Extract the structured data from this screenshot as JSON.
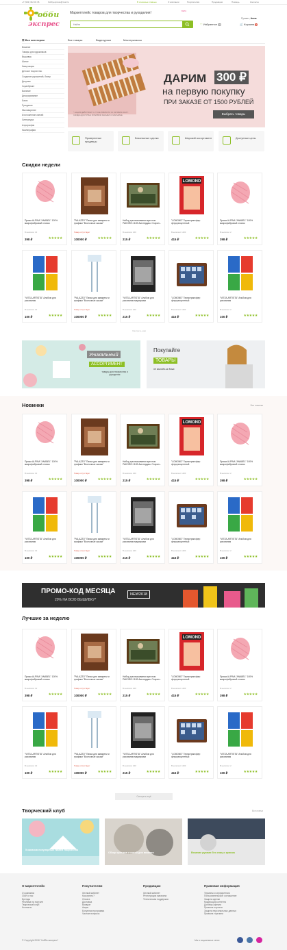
{
  "topbar": {
    "phone": "+7 (902) 342 34 36",
    "email": "hobbyexpress@mail.ru",
    "help": "В основные главные",
    "links": [
      "О компании",
      "Покупателям",
      "Продавцам",
      "Помощь",
      "Контакты"
    ]
  },
  "header": {
    "slogan": "Маркетплейс товаров для творчества и рукоделия!",
    "beta": "BETA",
    "greeting": "Привет,",
    "user": "Анна",
    "search_placeholder": "Найти",
    "favorites": "Избранное",
    "favorites_count": "99",
    "cart": "Корзина",
    "cart_count": "0"
  },
  "nav": {
    "all": "Все категории",
    "items": [
      "Все товары",
      "Видеоуроки",
      "Мастерклассы"
    ]
  },
  "sidebar": [
    "Вязание",
    "Товары для художников",
    "Вышивка",
    "Шитье",
    "Канцтовары",
    "Детское творчество",
    "Создание украшений, бисер",
    "Декупаж",
    "Скрапбукинг",
    "Валяние",
    "Декорирование",
    "Батик",
    "Рукоделие",
    "Мыловарение",
    "Изготовление свечей",
    "Литература",
    "Аэрография",
    "Каллиграфия"
  ],
  "banner": {
    "line1": "ДАРИМ",
    "amount": "300 ₽",
    "line2": "на первую покупку",
    "line3": "ПРИ ЗАКАЗЕ ОТ 1500 РУБЛЕЙ",
    "fine1": "* АКЦИЯ ДЕЙСТВУЕТ С 27 СЕНТЯБРЯ ПО 15 ОКТЯБРЯ 2018 Г.",
    "fine2": "СКИДКА ДОСТУПНА В ПЕРВОМ ЗАКАЗЕ В 1 МАГАЗИНЕ",
    "cta": "Выбрать товары"
  },
  "features": [
    "Проверенные продавцы",
    "Безопасные сделки",
    "Широкий ассортимент",
    "Доступные цены"
  ],
  "sections": {
    "sale": "Скидки недели",
    "new": "Новинки",
    "best": "Лучшие за неделю",
    "club": "Творческий клуб",
    "all": "Все новинки",
    "all2": "Все статьи",
    "show_more": "Смотреть ещё"
  },
  "products_row1": [
    {
      "name": "Пряжа ALPINA \"ANABEL\" 100% микрофибровый хлопок",
      "stock": "В наличии: 10",
      "price": "398 ₽"
    },
    {
      "name": "\"PALAZZO\" Папка для акварели и графики \"Восточные сказки\"",
      "stock": "Товар отсутствует",
      "price": "100000 ₽"
    },
    {
      "name": "Набор для вышивания крестом PAKORIS 1189 Амстердам. Старин...",
      "stock": "В наличии: 200",
      "price": "215 ₽"
    },
    {
      "name": "\"LOMOND\" Термотрансфер флуоресцентный",
      "stock": "В наличии: 1200",
      "price": "415 ₽"
    },
    {
      "name": "Пряжа ALPINA \"ANABEL\" 100% микрофибровый хлопок",
      "stock": "В наличии: 2",
      "price": "398 ₽"
    }
  ],
  "products_row2": [
    {
      "name": "\"VISTA-ARTISTA\" Альбом для рисования",
      "stock": "В наличии: 10",
      "price": "100 ₽"
    },
    {
      "name": "\"PALAZZO\" Папка для акварели и графики \"Восточные сказки\"",
      "stock": "Товар отсутствует",
      "price": "100000 ₽"
    },
    {
      "name": "\"VISTA-ARTISTA\" Альбом для рисования маркерами",
      "stock": "В наличии: 200",
      "price": "215 ₽"
    },
    {
      "name": "\"LOMOND\" Термотрансфер флуоресцентный",
      "stock": "В наличии: 1200",
      "price": "415 ₽"
    },
    {
      "name": "\"VISTA-ARTISTA\" Альбом для рисования",
      "stock": "В наличии: 2",
      "price": "100 ₽"
    }
  ],
  "promo1": {
    "t1": "Уникальный",
    "t2": "АССОРТИМЕНТ",
    "t3": "товары для творчества и рукоделия"
  },
  "promo2": {
    "t1": "Покупайте",
    "t2": "ТОВАРЫ",
    "t3": "не выходя из дома"
  },
  "promo_code": {
    "title": "ПРОМО-КОД МЕСЯЦА",
    "sub": "20% НА ВСЮ ВЫШИВКУ*",
    "code": "NEW2018"
  },
  "club": [
    "5 каналов популярных тканей творчества",
    "Обзор крючков и нитей для вязания",
    "Вязание руками без спиц и крючка"
  ],
  "footer": {
    "cols": [
      {
        "title": "О маркетплейс",
        "links": [
          "О компании",
          "СМИ о нас",
          "Бренды",
          "Реклама на портале",
          "Творческий клуб",
          "Контакты"
        ]
      },
      {
        "title": "Покупателям",
        "links": [
          "Личный кабинет",
          "Как купить?",
          "Оплата",
          "Доставка",
          "Возврат",
          "Акции",
          "Бонусная программа",
          "Частые вопросы"
        ]
      },
      {
        "title": "Продавцам",
        "links": [
          "Личный кабинет",
          "Регистрация магазина",
          "Техническая поддержка"
        ]
      },
      {
        "title": "Правовая информация",
        "links": [
          "Термины и определения",
          "Пользовательское соглашение",
          "Защита сделки",
          "Модерация контента",
          "Договор-оферта",
          "Правила портала",
          "Защита персональных данных",
          "Правила торговли"
        ]
      }
    ],
    "copyright": "© Copyright 2018 \"Хобби экспресс\"",
    "social": "Мы в социальных сетях"
  },
  "colors": {
    "accent": "#8dbf25",
    "sale": "#e05a47",
    "banner": "#f5dcdb"
  }
}
